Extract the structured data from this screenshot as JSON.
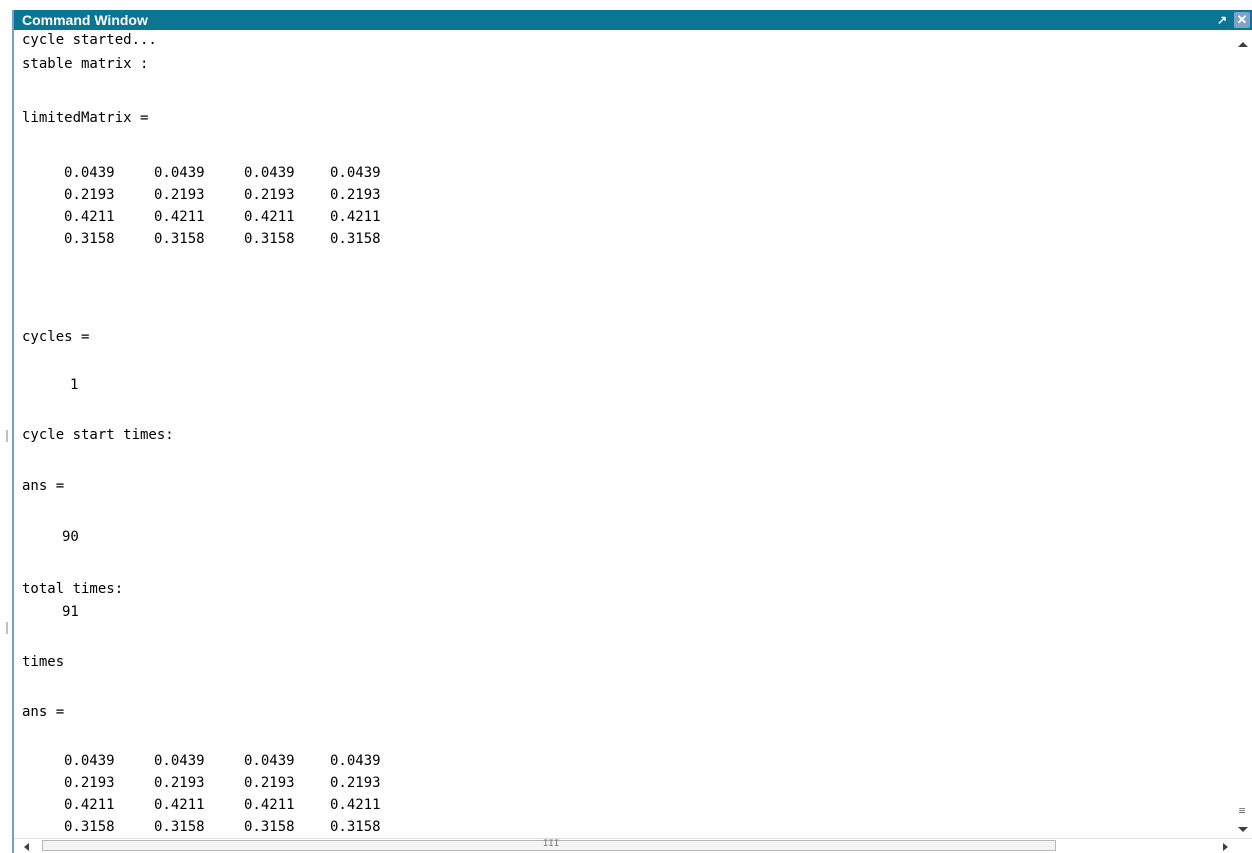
{
  "window": {
    "title": "Command Window",
    "undock_glyph": "↗",
    "close_glyph": "✕"
  },
  "output": {
    "line1": "cycle started...",
    "line2": "stable matrix :",
    "line3": "limitedMatrix =",
    "matrix1": [
      [
        "0.0439",
        "0.0439",
        "0.0439",
        "0.0439"
      ],
      [
        "0.2193",
        "0.2193",
        "0.2193",
        "0.2193"
      ],
      [
        "0.4211",
        "0.4211",
        "0.4211",
        "0.4211"
      ],
      [
        "0.3158",
        "0.3158",
        "0.3158",
        "0.3158"
      ]
    ],
    "cycles_label": "cycles =",
    "cycles_value": "1",
    "cycle_start_label": "cycle start times:",
    "ans1_label": "ans =",
    "ans1_value": "90",
    "total_times_label": "total times:",
    "total_times_value": "91",
    "times_label": "times",
    "ans2_label": "ans =",
    "matrix2": [
      [
        "0.0439",
        "0.0439",
        "0.0439",
        "0.0439"
      ],
      [
        "0.2193",
        "0.2193",
        "0.2193",
        "0.2193"
      ],
      [
        "0.4211",
        "0.4211",
        "0.4211",
        "0.4211"
      ],
      [
        "0.3158",
        "0.3158",
        "0.3158",
        "0.3158"
      ]
    ]
  },
  "scrollbar": {
    "grip_glyph": "≡",
    "h_grip_glyph": "III"
  }
}
